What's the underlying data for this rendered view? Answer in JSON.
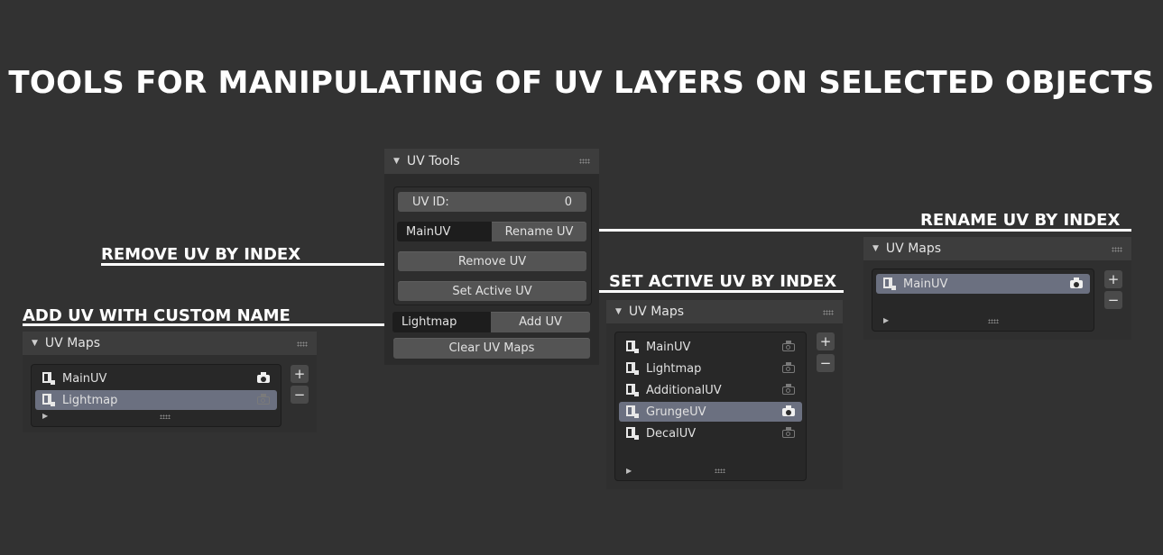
{
  "title": "TOOLS FOR MANIPULATING OF UV LAYERS ON SELECTED OBJECTS",
  "callouts": {
    "rename": "RENAME UV BY INDEX",
    "remove": "REMOVE UV BY INDEX",
    "set_active": "SET ACTIVE UV BY INDEX",
    "add": "ADD UV WITH CUSTOM NAME"
  },
  "uv_tools": {
    "header": "UV Tools",
    "uv_id_label": "UV ID:",
    "uv_id_value": "0",
    "rename_field": "MainUV",
    "rename_button": "Rename UV",
    "remove_button": "Remove UV",
    "set_active_button": "Set Active UV",
    "add_field": "Lightmap",
    "add_button": "Add UV",
    "clear_button": "Clear UV Maps"
  },
  "uv_maps_left": {
    "header": "UV Maps",
    "items": [
      {
        "name": "MainUV",
        "selected": false,
        "render_active": true
      },
      {
        "name": "Lightmap",
        "selected": true,
        "render_active": false
      }
    ],
    "plus": "+",
    "minus": "−"
  },
  "uv_maps_center": {
    "header": "UV Maps",
    "items": [
      {
        "name": "MainUV",
        "selected": false,
        "render_active": false
      },
      {
        "name": "Lightmap",
        "selected": false,
        "render_active": false
      },
      {
        "name": "AdditionalUV",
        "selected": false,
        "render_active": false
      },
      {
        "name": "GrungeUV",
        "selected": true,
        "render_active": true
      },
      {
        "name": "DecalUV",
        "selected": false,
        "render_active": false
      }
    ],
    "plus": "+",
    "minus": "−"
  },
  "uv_maps_right": {
    "header": "UV Maps",
    "items": [
      {
        "name": "MainUV",
        "selected": true,
        "render_active": true
      }
    ],
    "plus": "+",
    "minus": "−"
  },
  "colors": {
    "background": "#323232",
    "panel_header": "#3d3d3d",
    "button": "#545454",
    "selected_row": "#6b7080",
    "callout_text": "#ffffff"
  }
}
